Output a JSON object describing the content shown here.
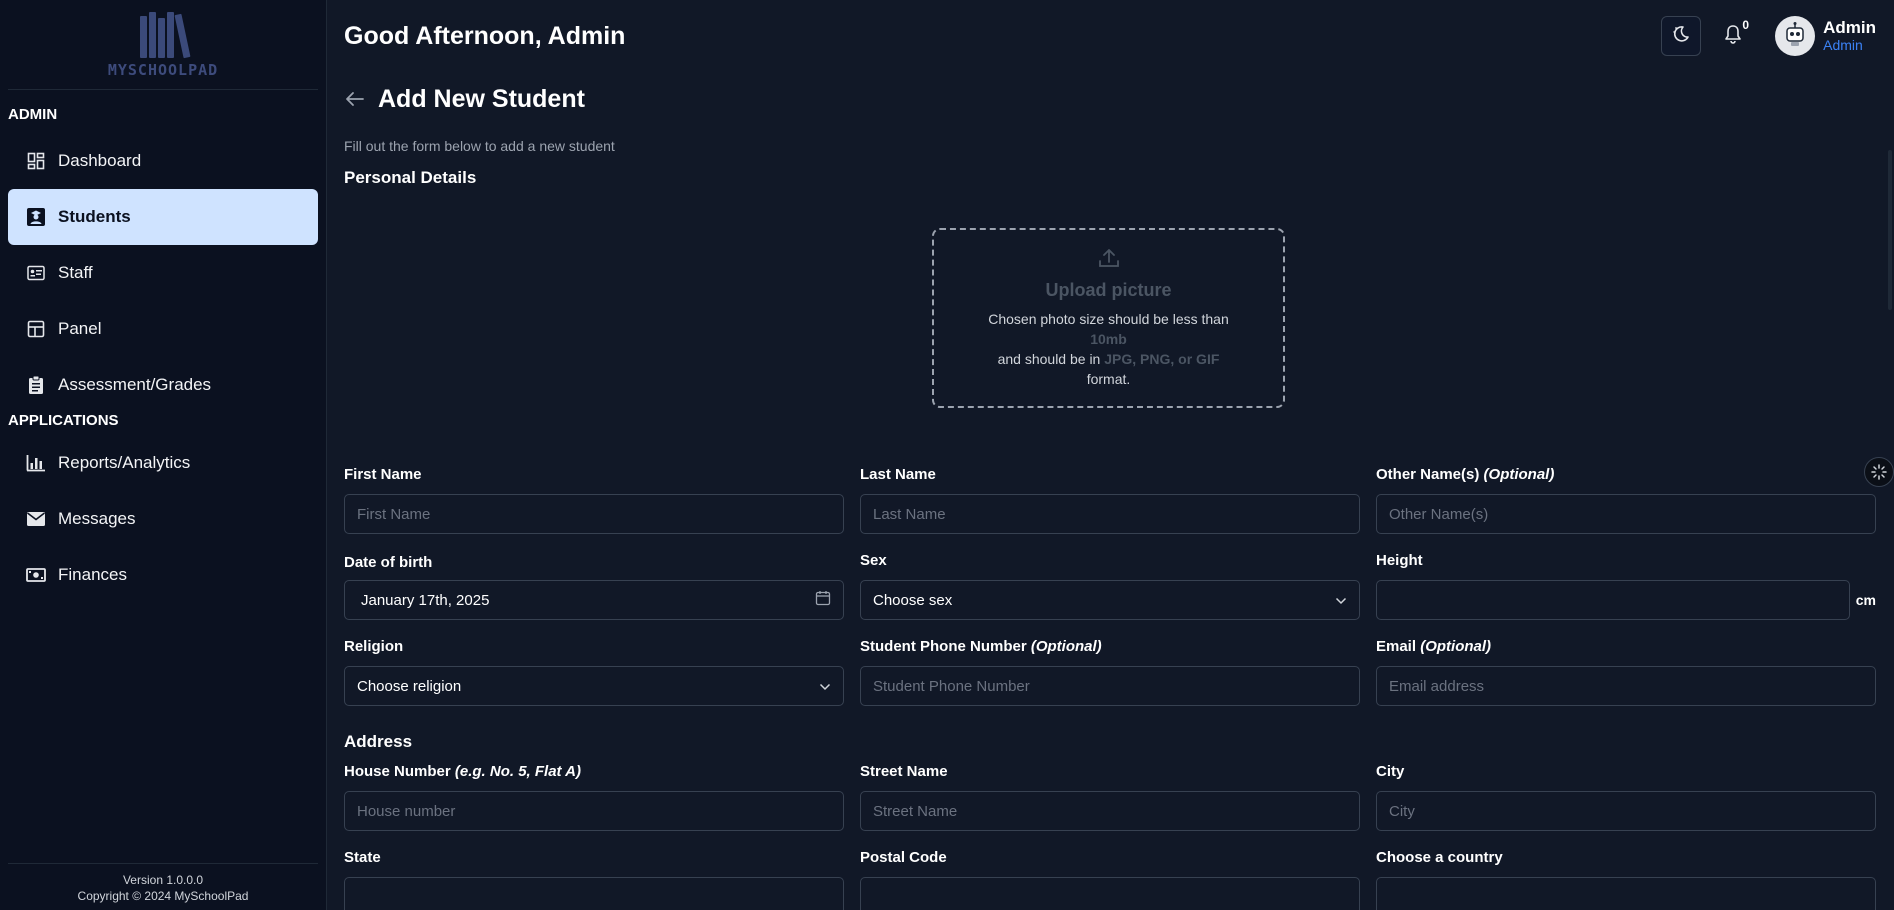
{
  "brand": {
    "logo_text": "MYSCHOOLPAD"
  },
  "sidebar": {
    "section_admin": "ADMIN",
    "section_applications": "APPLICATIONS",
    "admin_items": [
      {
        "label": "Dashboard",
        "icon": "dashboard-icon"
      },
      {
        "label": "Students",
        "icon": "student-icon",
        "active": true
      },
      {
        "label": "Staff",
        "icon": "staff-icon"
      },
      {
        "label": "Panel",
        "icon": "panel-icon"
      },
      {
        "label": "Assessment/Grades",
        "icon": "clipboard-icon"
      }
    ],
    "app_items": [
      {
        "label": "Reports/Analytics",
        "icon": "chart-icon"
      },
      {
        "label": "Messages",
        "icon": "envelope-icon"
      },
      {
        "label": "Finances",
        "icon": "money-icon"
      }
    ],
    "footer": {
      "version": "Version 1.0.0.0",
      "copyright": "Copyright © 2024 MySchoolPad"
    }
  },
  "header": {
    "greeting": "Good Afternoon, Admin",
    "notification_count": "0",
    "user_name": "Admin",
    "user_role": "Admin"
  },
  "page": {
    "title": "Add New Student",
    "subtitle": "Fill out the form below to add a new student",
    "personal_details": "Personal Details",
    "address": "Address"
  },
  "upload": {
    "title": "Upload picture",
    "line1": "Chosen photo size should be less than",
    "size": "10mb",
    "line2": "and should be in",
    "formats": "JPG, PNG, or GIF",
    "line3": "format."
  },
  "form": {
    "first_name": {
      "label": "First Name",
      "placeholder": "First Name"
    },
    "last_name": {
      "label": "Last Name",
      "placeholder": "Last Name"
    },
    "other_names": {
      "label": "Other Name(s)",
      "optional": "(Optional)",
      "placeholder": "Other Name(s)"
    },
    "dob": {
      "label": "Date of birth",
      "value": "January 17th, 2025"
    },
    "sex": {
      "label": "Sex",
      "value": "Choose sex"
    },
    "height": {
      "label": "Height",
      "unit": "cm"
    },
    "religion": {
      "label": "Religion",
      "value": "Choose religion"
    },
    "phone": {
      "label": "Student Phone Number",
      "optional": "(Optional)",
      "placeholder": "Student Phone Number"
    },
    "email": {
      "label": "Email",
      "optional": "(Optional)",
      "placeholder": "Email address"
    },
    "house_number": {
      "label": "House Number",
      "hint": "(e.g. No. 5, Flat A)",
      "placeholder": "House number"
    },
    "street": {
      "label": "Street Name",
      "placeholder": "Street Name"
    },
    "city": {
      "label": "City",
      "placeholder": "City"
    },
    "state": {
      "label": "State"
    },
    "postal": {
      "label": "Postal Code"
    },
    "country": {
      "label": "Choose a country"
    }
  }
}
